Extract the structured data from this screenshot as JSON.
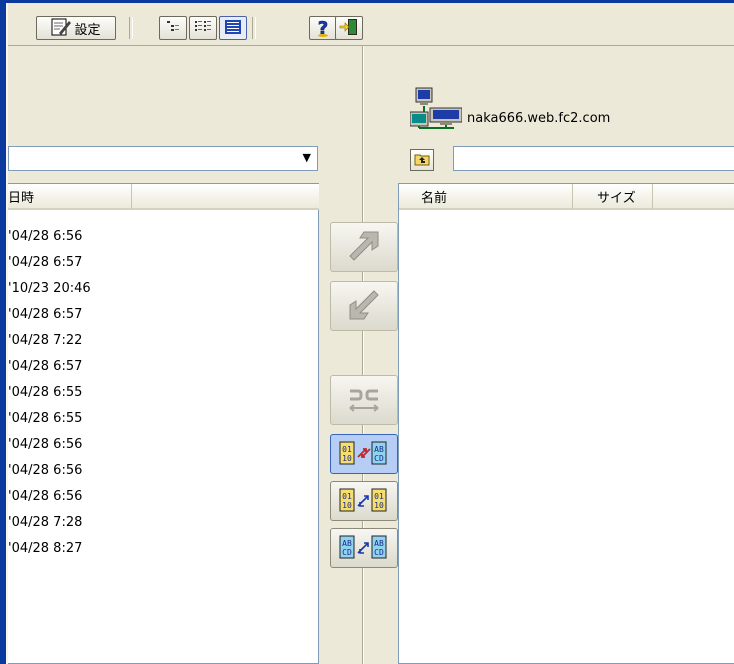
{
  "toolbar": {
    "settings_label": "設定"
  },
  "right": {
    "server_name": "naka666.web.fc2.com",
    "columns": [
      "名前",
      "サイズ"
    ]
  },
  "left": {
    "columns": [
      "日時",
      ""
    ],
    "rows": [
      "'04/28 6:56",
      "'04/28 6:57",
      "'10/23 20:46",
      "'04/28 6:57",
      "'04/28 7:22",
      "'04/28 6:57",
      "'04/28 6:55",
      "'04/28 6:55",
      "'04/28 6:56",
      "'04/28 6:56",
      "'04/28 6:56",
      "'04/28 7:28",
      "'04/28 8:27"
    ]
  },
  "colors": {
    "frame": "#0a3a9e",
    "face": "#ece9d8",
    "list_border": "#7f9db9",
    "active_button": "#b6cdf5"
  },
  "icons": [
    "edit-icon",
    "tree-view-icon",
    "list-view-icon",
    "detail-view-icon",
    "help-icon",
    "exit-icon",
    "server-icon",
    "folder-up-icon",
    "upload-arrow-icon",
    "download-arrow-icon",
    "mirror-icon",
    "binary-ascii-icon",
    "binary-icon",
    "ascii-icon"
  ]
}
